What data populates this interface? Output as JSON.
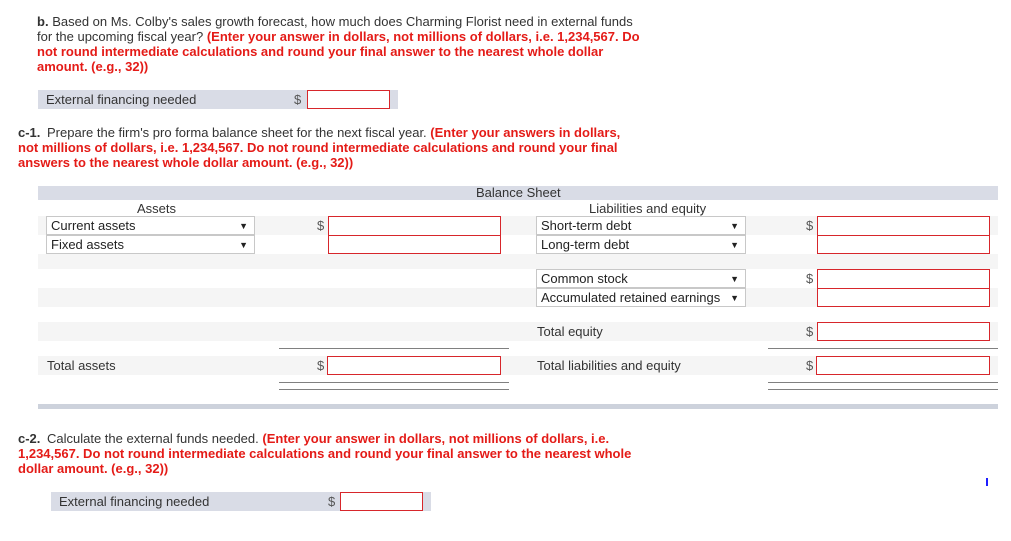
{
  "part_b": {
    "label": "b.",
    "question": "Based on Ms. Colby's sales growth forecast, how much does Charming Florist need in external funds for the upcoming fiscal year?",
    "instruction": "(Enter your answer in dollars, not millions of dollars, i.e. 1,234,567. Do not round intermediate calculations and round your final answer to the nearest whole dollar amount. (e.g., 32))",
    "row_label": "External financing needed",
    "currency": "$",
    "value": ""
  },
  "part_c1": {
    "label": "c-1.",
    "question": "Prepare the firm's pro forma balance sheet for the next fiscal year.",
    "instruction": "(Enter your answers in dollars, not millions of dollars, i.e. 1,234,567. Do not round intermediate calculations and round your final answers to the nearest whole dollar amount. (e.g., 32))"
  },
  "balance_sheet": {
    "title": "Balance Sheet",
    "assets_header": "Assets",
    "liabilities_header": "Liabilities and equity",
    "currency": "$",
    "assets": [
      {
        "selected": "Current assets",
        "value": ""
      },
      {
        "selected": "Fixed assets",
        "value": ""
      }
    ],
    "liabilities": [
      {
        "selected": "Short-term debt",
        "value": ""
      },
      {
        "selected": "Long-term debt",
        "value": ""
      }
    ],
    "equity": [
      {
        "selected": "Common stock",
        "value": ""
      },
      {
        "selected": "Accumulated retained earnings",
        "value": ""
      }
    ],
    "total_equity_label": "Total equity",
    "total_assets_label": "Total assets",
    "total_liabilities_equity_label": "Total liabilities and equity",
    "dropdown_arrow": "▼"
  },
  "part_c2": {
    "label": "c-2.",
    "question": "Calculate the external funds needed.",
    "instruction": "(Enter your answer in dollars, not millions of dollars, i.e. 1,234,567. Do not round intermediate calculations and round your final answer to the nearest whole dollar amount. (e.g., 32))",
    "row_label": "External financing needed",
    "currency": "$",
    "value": ""
  }
}
